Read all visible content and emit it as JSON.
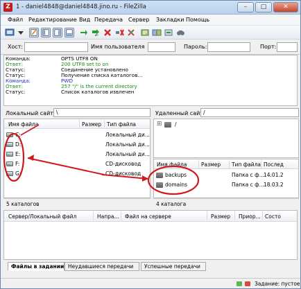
{
  "window": {
    "title": "1 - daniel4848@daniel4848.jino.ru - FileZilla",
    "app_icon_letter": "Z",
    "buttons": [
      "–",
      "□",
      "✕"
    ]
  },
  "menu": [
    "Файл",
    "Редактирование",
    "Вид",
    "Передача",
    "Сервер",
    "Закладки",
    "Помощь"
  ],
  "quickconnect": {
    "host_label": "Хост:",
    "user_label": "Имя пользователя",
    "pass_label": "Пароль:",
    "port_label": "Порт:"
  },
  "log": [
    {
      "k": "Команда:",
      "v": "OPTS UTF8 ON",
      "kc": "",
      "vc": ""
    },
    {
      "k": "Ответ:",
      "v": "200 UTF8 set to on",
      "kc": "green",
      "vc": "green"
    },
    {
      "k": "Статус:",
      "v": "Соединение установлено",
      "kc": "",
      "vc": ""
    },
    {
      "k": "Статус:",
      "v": "Получение списка каталогов...",
      "kc": "",
      "vc": ""
    },
    {
      "k": "Команда:",
      "v": "PWD",
      "kc": "blue",
      "vc": "blue"
    },
    {
      "k": "Ответ:",
      "v": "257 \"/\" is the current directory",
      "kc": "green",
      "vc": "green"
    },
    {
      "k": "Статус:",
      "v": "Список каталогов извлечен",
      "kc": "",
      "vc": ""
    }
  ],
  "local": {
    "site_label": "Локальный сайт:",
    "path": "\\",
    "columns": {
      "name": "Имя файла",
      "size": "Размер",
      "type": "Тип файла"
    },
    "rows": [
      {
        "name": "C:",
        "type": "Локальный ди..."
      },
      {
        "name": "D:",
        "type": "Локальный ди..."
      },
      {
        "name": "E:",
        "type": "Локальный ди..."
      },
      {
        "name": "F:",
        "type": "CD-дисковод"
      },
      {
        "name": "G:",
        "type": "CD-дисковод"
      }
    ],
    "status": "5 каталогов"
  },
  "remote": {
    "site_label": "Удаленный сайт:",
    "path": "/",
    "tree_root": "/",
    "tree_toggle": "⊞",
    "columns": {
      "name": "Имя файла",
      "size": "Размер",
      "type": "Тип файла",
      "modified": "Послед"
    },
    "rows": [
      {
        "name": "backups",
        "type": "Папка с ф...",
        "modified": "14.01.2"
      },
      {
        "name": "domains",
        "type": "Папка с ф...",
        "modified": "18.03.2"
      }
    ],
    "status": "4 каталога"
  },
  "queue": {
    "columns": [
      "Сервер/Локальный файл",
      "Напра...",
      "Файл на сервере",
      "Размер",
      "Приор...",
      "Состо"
    ],
    "tabs": [
      "Файлы в задании",
      "Неудавшиеся передачи",
      "Успешные передачи"
    ]
  },
  "statusbar": {
    "queue_text": "Задание: пустое"
  },
  "colors": {
    "annotation_red": "#d0191e",
    "log_green": "#1b8a16",
    "log_blue": "#1f2fd1"
  }
}
